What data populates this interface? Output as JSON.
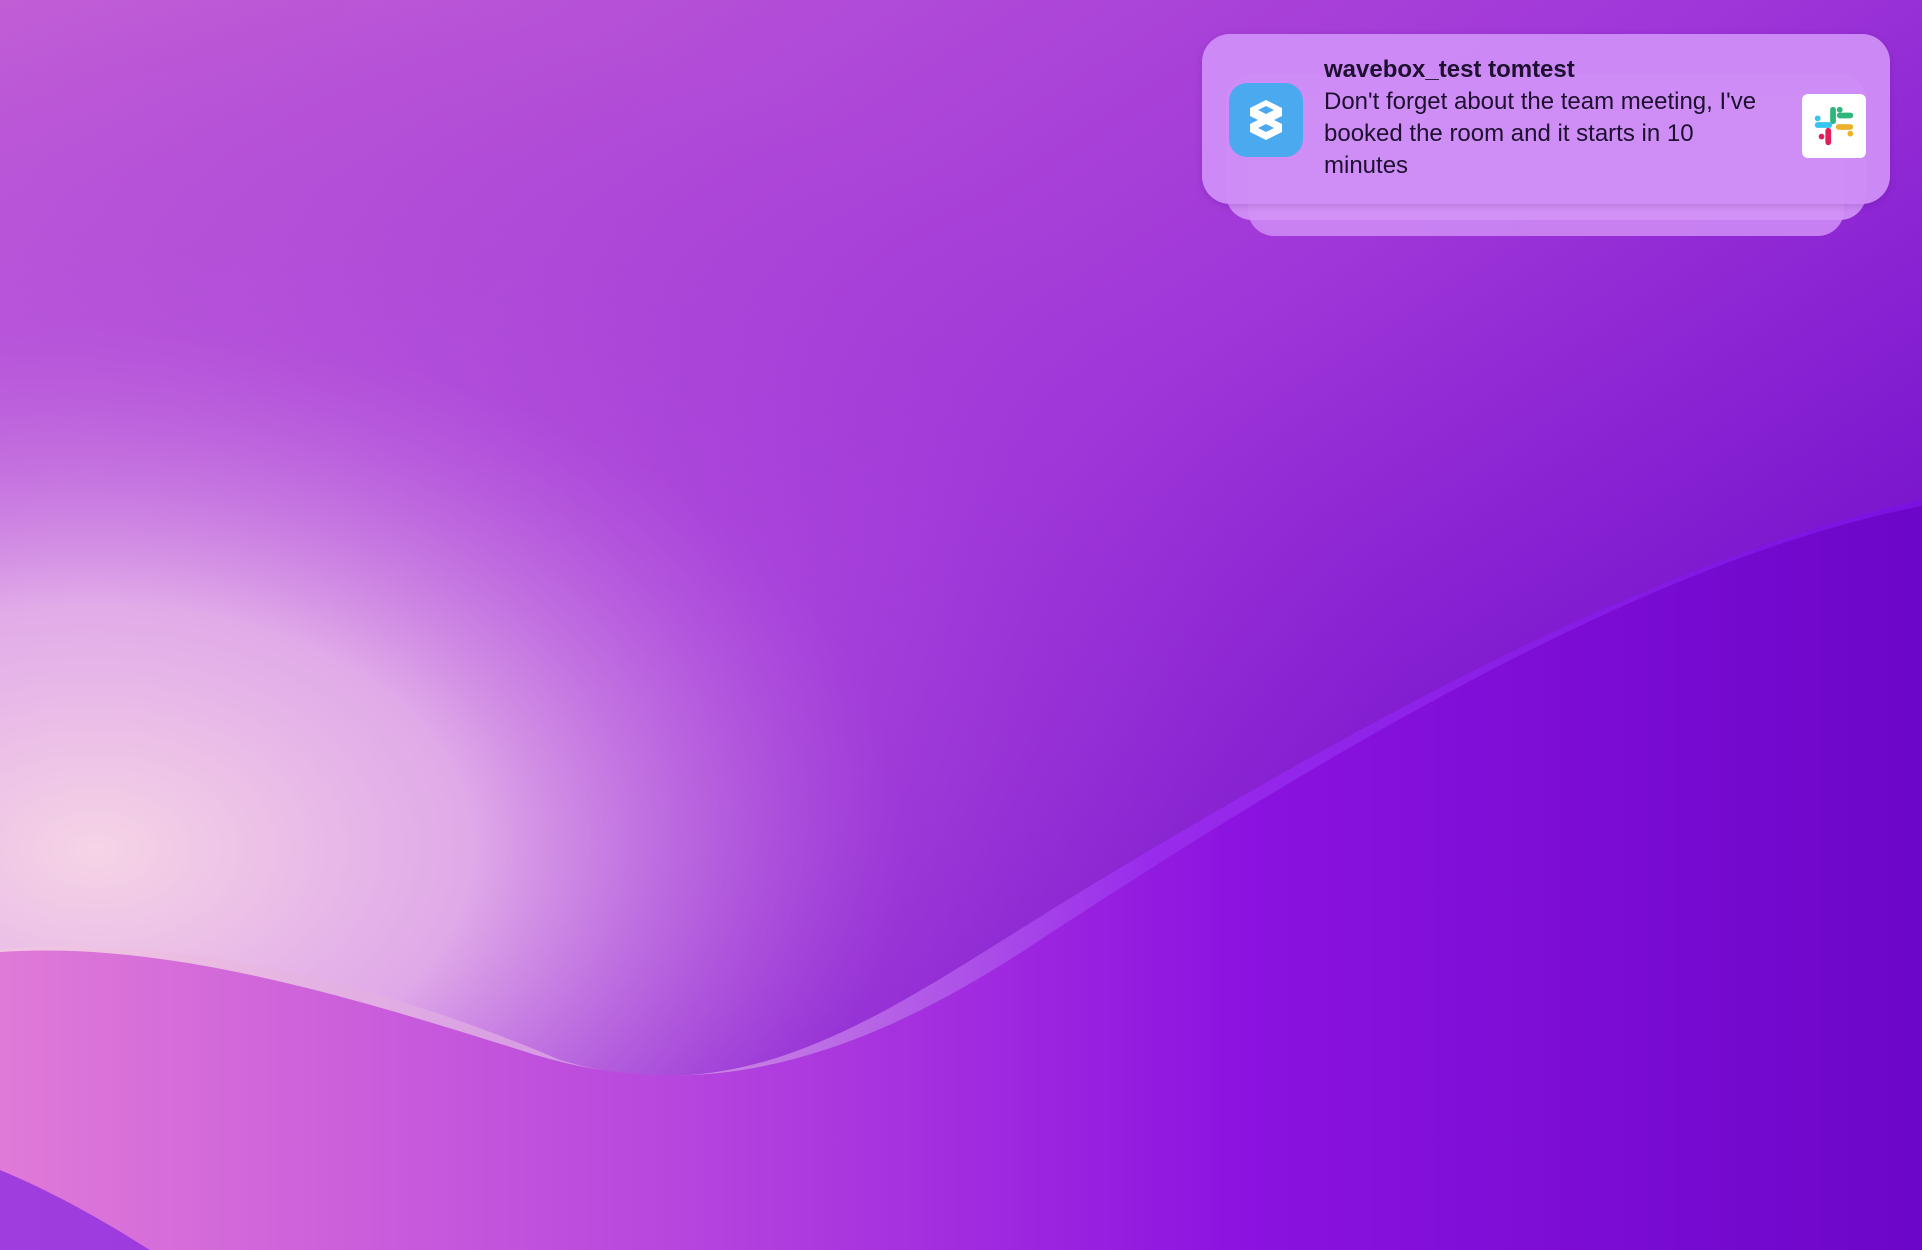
{
  "notification": {
    "title": "wavebox_test tomtest",
    "body": "Don't forget about the team meeting, I've booked the room and it starts in 10 minutes",
    "app_icon": "wavebox-icon",
    "attachment_icon": "slack-icon"
  },
  "colors": {
    "wallpaper_light": "#f3cde6",
    "wallpaper_dark": "#5506b0",
    "wavebox_blue": "#4aa9ef"
  }
}
